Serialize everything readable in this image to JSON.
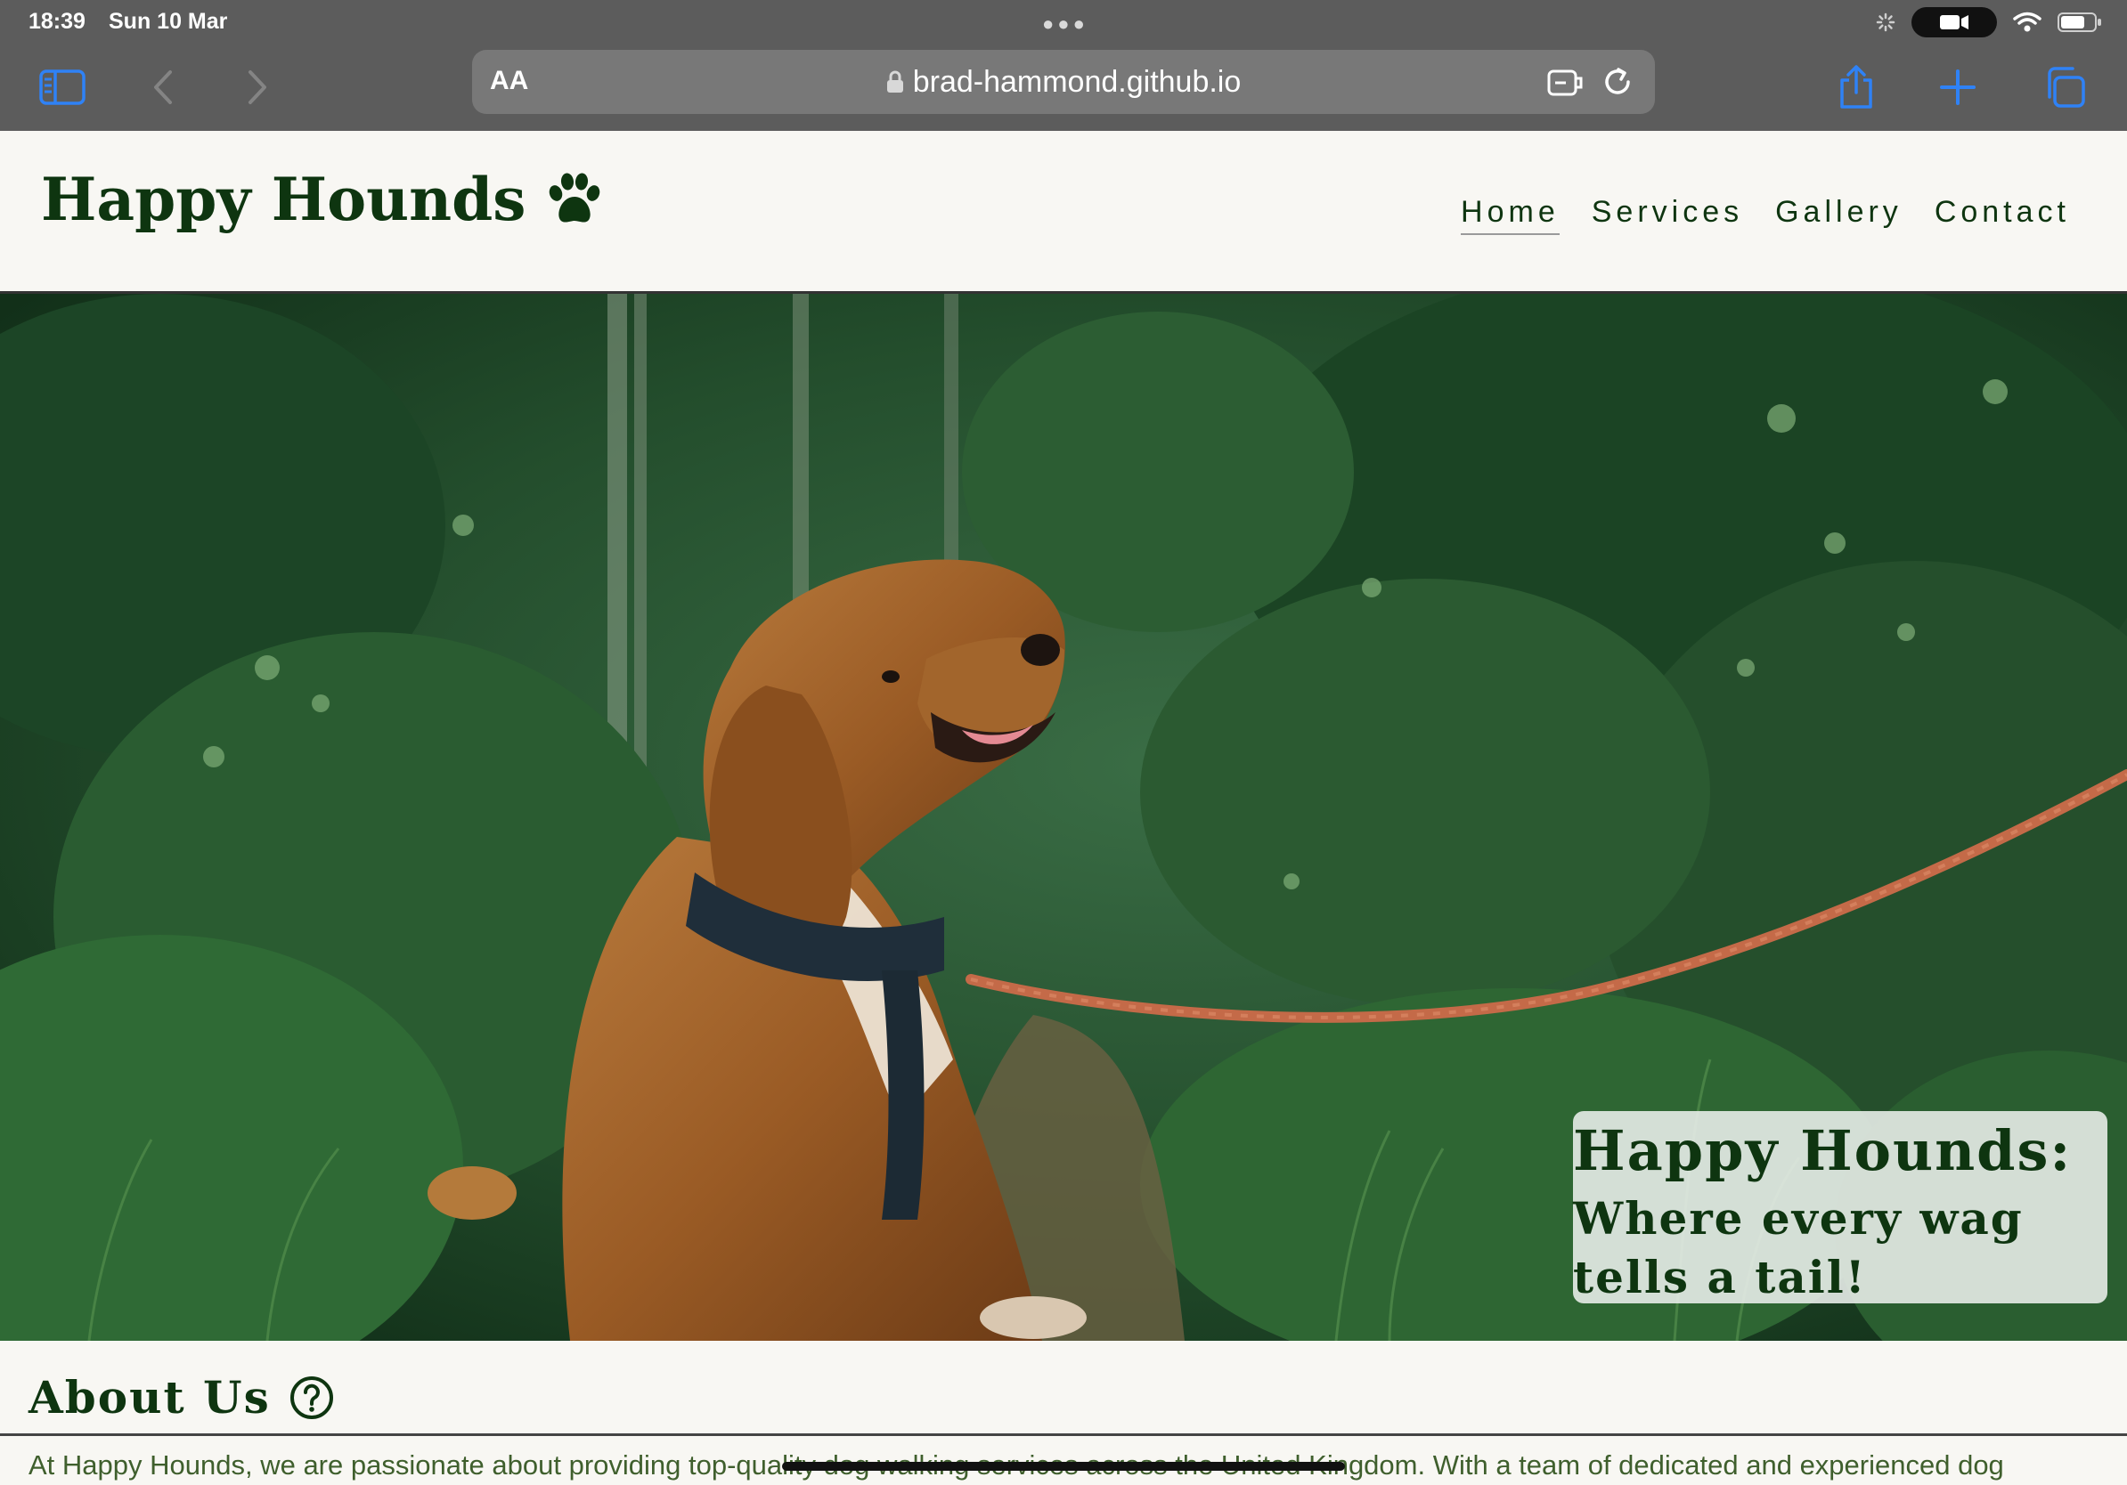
{
  "status_bar": {
    "time": "18:39",
    "date": "Sun 10 Mar"
  },
  "browser": {
    "text_size_label": "AA",
    "url": "brad-hammond.github.io",
    "accent_color": "#2f82f6"
  },
  "site": {
    "logo_text": "Happy Hounds",
    "logo_icon": "paw-icon",
    "brand_color": "#0e3510",
    "nav": [
      {
        "label": "Home",
        "active": true
      },
      {
        "label": "Services",
        "active": false
      },
      {
        "label": "Gallery",
        "active": false
      },
      {
        "label": "Contact",
        "active": false
      }
    ]
  },
  "hero": {
    "title": "Happy Hounds:",
    "subtitle": "Where every wag tells a tail!",
    "image": "dog-in-forest-photo"
  },
  "about": {
    "title": "About Us",
    "icon": "question-circle-icon",
    "text": "At Happy Hounds, we are passionate about providing top-quality dog walking services across the United Kingdom. With a team of dedicated and experienced dog"
  }
}
